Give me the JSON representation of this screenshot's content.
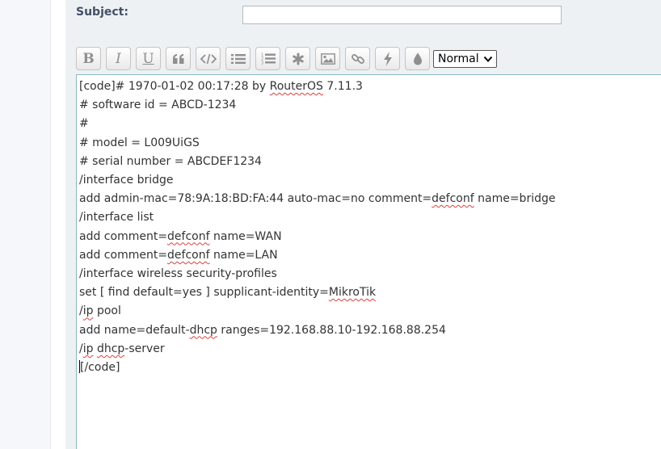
{
  "subject": {
    "label": "Subject:",
    "value": ""
  },
  "toolbar": {
    "buttons": [
      {
        "icon": "bold-icon",
        "glyph": "B"
      },
      {
        "icon": "italic-icon",
        "glyph": "I"
      },
      {
        "icon": "underline-icon",
        "glyph": "U"
      },
      {
        "icon": "quote-icon"
      },
      {
        "icon": "code-icon"
      },
      {
        "icon": "list-icon"
      },
      {
        "icon": "numbered-list-icon"
      },
      {
        "icon": "asterisk-icon"
      },
      {
        "icon": "image-icon"
      },
      {
        "icon": "link-icon"
      },
      {
        "icon": "flash-icon"
      },
      {
        "icon": "color-icon"
      }
    ],
    "font_size_value": "Normal"
  },
  "editor": {
    "lines": [
      [
        "[code]# 1970-01-02 00:17:28 by ",
        "RouterOS",
        " 7.11.3"
      ],
      [
        "# software id = ABCD-1234"
      ],
      [
        "#"
      ],
      [
        "# model = L009UiGS"
      ],
      [
        "# serial number = ABCDEF1234"
      ],
      [
        "/interface bridge"
      ],
      [
        "add admin-mac=78:9A:18:BD:FA:44 auto-mac=no comment=",
        "defconf",
        " name=bridge"
      ],
      [
        "/interface list"
      ],
      [
        "add comment=",
        "defconf",
        " name=WAN"
      ],
      [
        "add comment=",
        "defconf",
        " name=LAN"
      ],
      [
        "/interface wireless security-profiles"
      ],
      [
        "set [ find default=yes ] supplicant-identity=",
        "MikroTik"
      ],
      [
        "/",
        "ip",
        " pool"
      ],
      [
        "add name=default-",
        "dhcp",
        " ranges=192.168.88.10-192.168.88.254"
      ],
      [
        "/",
        "ip",
        " ",
        "dhcp",
        "-server"
      ],
      [
        "[/code]"
      ]
    ]
  },
  "colors": {
    "panel_bg": "#eef1f4",
    "label_color": "#425067",
    "editor_border": "#8ab7bf",
    "spell_underline": "#e0403a"
  }
}
